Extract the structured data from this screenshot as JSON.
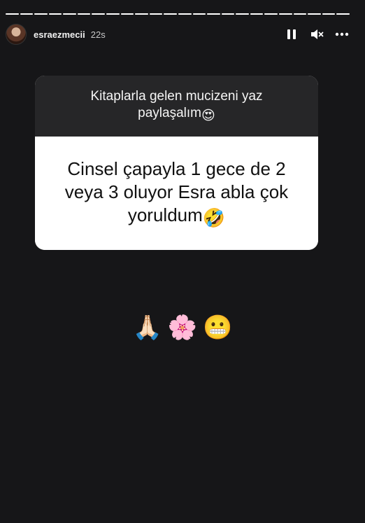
{
  "story": {
    "username": "esraezmecii",
    "time": "22s",
    "segments": 24,
    "active_segment_progress": 1.0
  },
  "controls": {
    "pause_icon": "pause-icon",
    "mute_icon": "speaker-muted-icon",
    "more_icon": "more-horizontal-icon"
  },
  "question_sticker": {
    "prompt": "Kitaplarla gelen mucizeni yaz paylaşalım",
    "prompt_emoji": "😍",
    "answer": "Cinsel çapayla 1 gece de 2 veya 3 oluyor Esra abla çok yoruldum",
    "answer_emoji": "🤣"
  },
  "emoji_row": {
    "e1": "🙏🏻",
    "e2": "🌸",
    "e3": "😬"
  },
  "colors": {
    "background": "#161618",
    "card_top": "#262628",
    "card_bottom": "#ffffff"
  }
}
